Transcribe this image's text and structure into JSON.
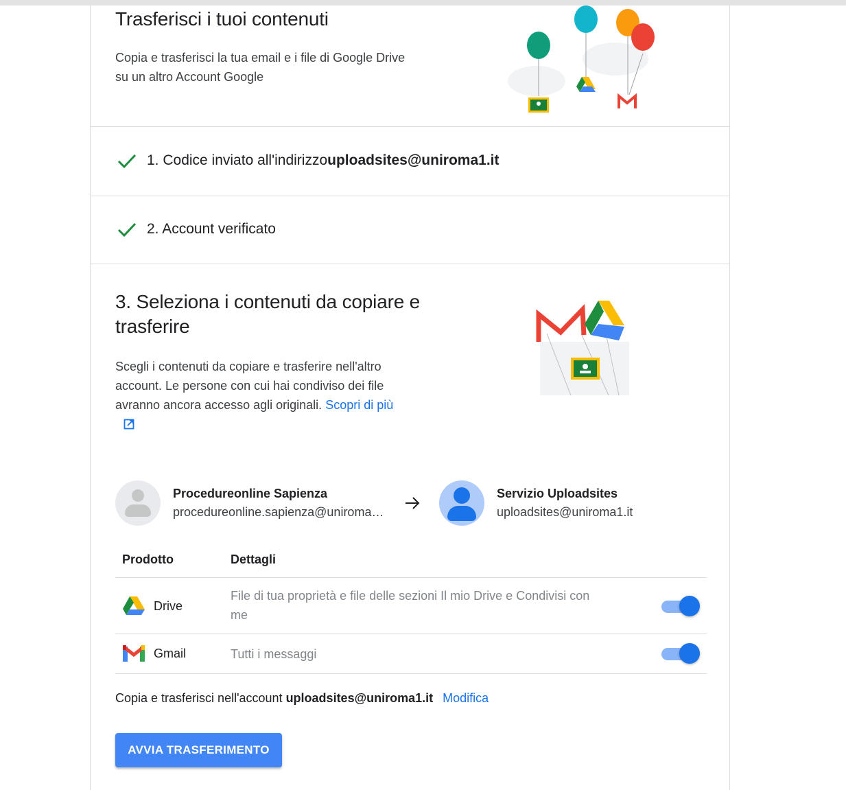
{
  "header": {
    "title": "Trasferisci i tuoi contenuti",
    "desc_line1": "Copia e trasferisci la tua email e i file di Google Drive",
    "desc_line2": "su un altro Account Google"
  },
  "steps": [
    {
      "label": "1. Codice inviato all'indirizzo ",
      "email": "uploadsites@uniroma1.it"
    },
    {
      "label": "2. Account verificato"
    }
  ],
  "step3": {
    "title_line1": "3. Seleziona i contenuti da copiare e",
    "title_line2": "trasferire",
    "desc_line1": "Scegli i contenuti da copiare e trasferire nell'altro",
    "desc_line2": "account. Le persone con cui hai condiviso dei file",
    "desc_line3": "avranno ancora accesso agli originali. ",
    "learn_more": "Scopri di più"
  },
  "source_account": {
    "name": "Procedureonline Sapienza",
    "email": "procedureonline.sapienza@uniroma1.it"
  },
  "target_account": {
    "name": "Servizio Uploadsites",
    "email": "uploadsites@uniroma1.it"
  },
  "table": {
    "col_product": "Prodotto",
    "col_details": "Dettagli",
    "rows": [
      {
        "product": "Drive",
        "icon": "drive-icon",
        "details_line1": "File di tua proprietà e file delle sezioni Il mio Drive e Condivisi con",
        "details_line2": "me",
        "enabled": true
      },
      {
        "product": "Gmail",
        "icon": "gmail-icon",
        "details_line1": "Tutti i messaggi",
        "enabled": true
      }
    ]
  },
  "footer": {
    "prefix": "Copia e trasferisci nell'account ",
    "email": "uploadsites@uniroma1.it",
    "edit": "Modifica"
  },
  "start_button": "AVVIA TRASFERIMENTO",
  "colors": {
    "accent": "#1a73e8",
    "button": "#4285f4",
    "check": "#1e8e3e"
  }
}
